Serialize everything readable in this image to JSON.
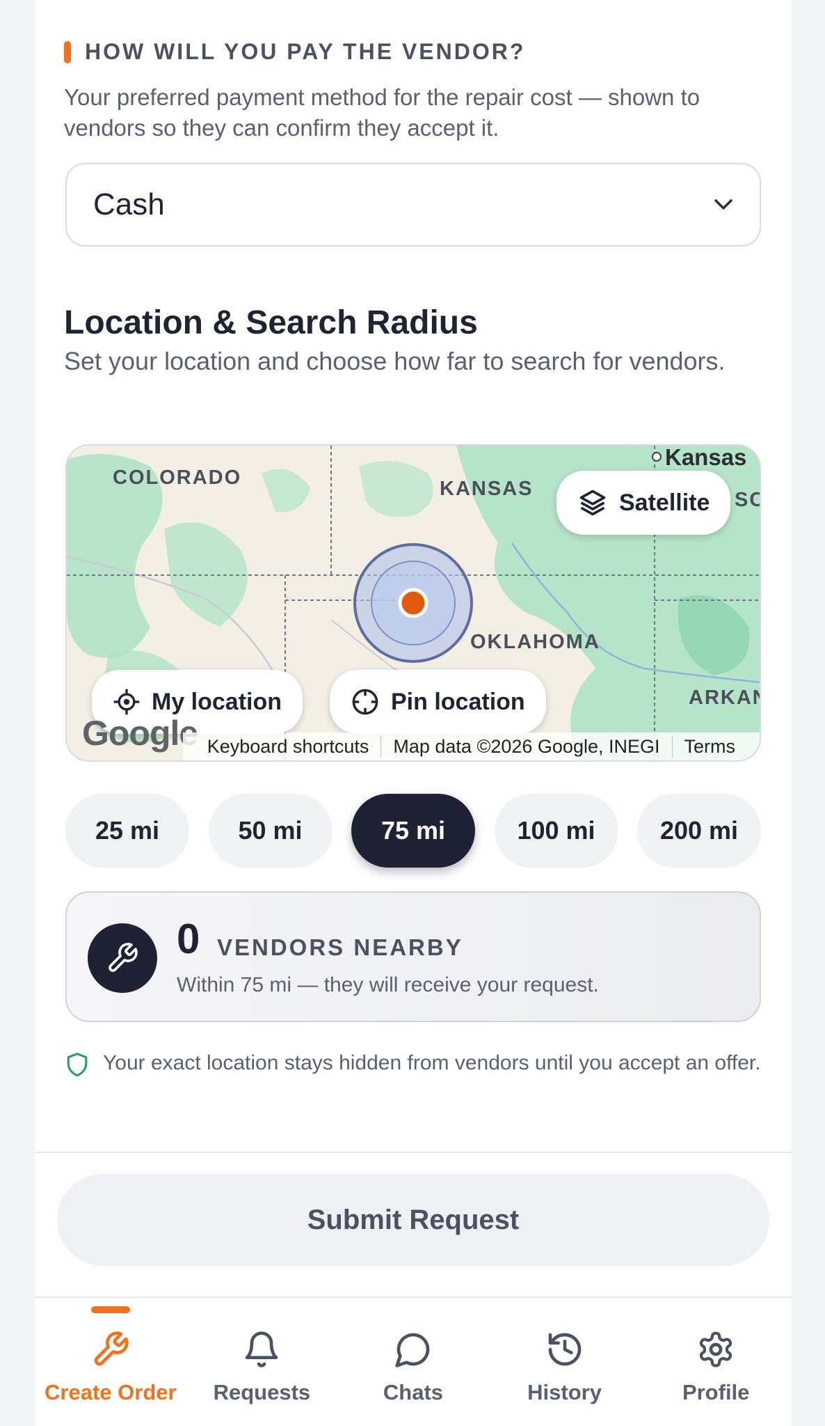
{
  "payment": {
    "section_title": "HOW WILL YOU PAY THE VENDOR?",
    "description": "Your preferred payment method for the repair cost — shown to vendors so they can confirm they accept it.",
    "selected_value": "Cash"
  },
  "location": {
    "title": "Location & Search Radius",
    "description": "Set your location and choose how far to search for vendors."
  },
  "map": {
    "labels": {
      "colorado": "COLORADO",
      "kansas": "KANSAS",
      "kansas_city": "Kansas",
      "oklahoma": "OKLAHOMA",
      "arkansas": "ARKAN",
      "missouri": "SC"
    },
    "satellite_label": "Satellite",
    "my_location_label": "My location",
    "pin_location_label": "Pin location",
    "google_logo": "Google",
    "attribution": {
      "shortcuts": "Keyboard shortcuts",
      "map_data": "Map data ©2026 Google, INEGI",
      "terms": "Terms"
    }
  },
  "radius": {
    "options": [
      "25 mi",
      "50 mi",
      "75 mi",
      "100 mi",
      "200 mi"
    ],
    "selected": "75 mi"
  },
  "vendors": {
    "count": "0",
    "label": "VENDORS NEARBY",
    "subtitle": "Within 75 mi — they will receive your request."
  },
  "privacy_note": "Your exact location stays hidden from vendors until you accept an offer.",
  "submit_label": "Submit Request",
  "nav": {
    "items": [
      {
        "label": "Create Order",
        "icon": "wrench-icon"
      },
      {
        "label": "Requests",
        "icon": "bell-icon"
      },
      {
        "label": "Chats",
        "icon": "chat-bubble-icon"
      },
      {
        "label": "History",
        "icon": "history-icon"
      },
      {
        "label": "Profile",
        "icon": "gear-icon"
      }
    ],
    "active": "Create Order"
  },
  "colors": {
    "accent": "#f2711c",
    "dark": "#1e2234",
    "map_marker": "#e4590f"
  }
}
